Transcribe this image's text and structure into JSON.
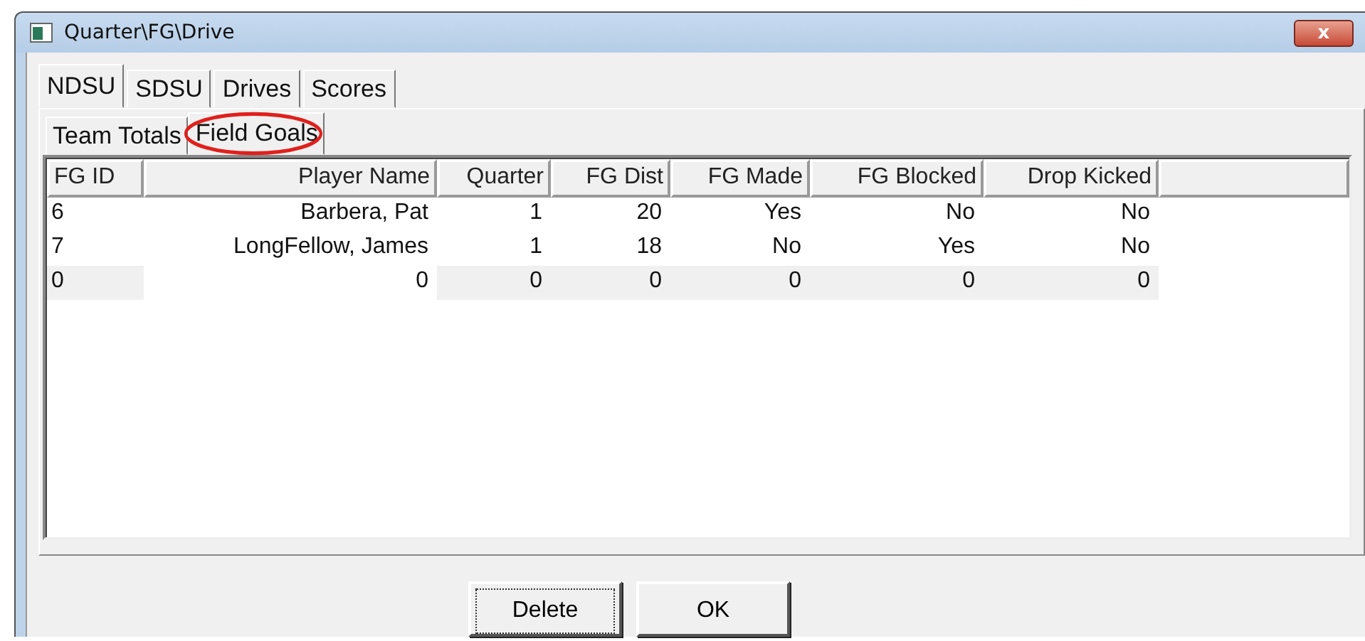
{
  "window": {
    "title": "Quarter\\FG\\Drive",
    "close": "x"
  },
  "tabs": [
    {
      "label": "NDSU",
      "selected": true
    },
    {
      "label": "SDSU",
      "selected": false
    },
    {
      "label": "Drives",
      "selected": false
    },
    {
      "label": "Scores",
      "selected": false
    }
  ],
  "subtabs": [
    {
      "label": "Team Totals",
      "selected": false,
      "circled": false
    },
    {
      "label": "Field Goals",
      "selected": true,
      "circled": true
    }
  ],
  "table": {
    "columns": [
      "FG ID",
      "Player Name",
      "Quarter",
      "FG Dist",
      "FG Made",
      "FG Blocked",
      "Drop Kicked"
    ],
    "rows": [
      {
        "cells": [
          {
            "text": "6",
            "shaded": false
          },
          {
            "text": "Barbera, Pat",
            "shaded": false
          },
          {
            "text": "1",
            "shaded": false
          },
          {
            "text": "20",
            "shaded": false
          },
          {
            "text": "Yes",
            "shaded": false
          },
          {
            "text": "No",
            "shaded": false
          },
          {
            "text": "No",
            "shaded": false
          }
        ]
      },
      {
        "cells": [
          {
            "text": "7",
            "shaded": false
          },
          {
            "text": "LongFellow, James",
            "shaded": false
          },
          {
            "text": "1",
            "shaded": false
          },
          {
            "text": "18",
            "shaded": false
          },
          {
            "text": "No",
            "shaded": false
          },
          {
            "text": "Yes",
            "shaded": false
          },
          {
            "text": "No",
            "shaded": false
          }
        ]
      },
      {
        "cells": [
          {
            "text": "0",
            "shaded": true
          },
          {
            "text": "0",
            "shaded": false
          },
          {
            "text": "0",
            "shaded": true
          },
          {
            "text": "0",
            "shaded": true
          },
          {
            "text": "0",
            "shaded": true
          },
          {
            "text": "0",
            "shaded": true
          },
          {
            "text": "0",
            "shaded": true
          }
        ]
      }
    ]
  },
  "buttons": [
    {
      "label": "Delete",
      "focused": true
    },
    {
      "label": "OK",
      "focused": false
    }
  ]
}
